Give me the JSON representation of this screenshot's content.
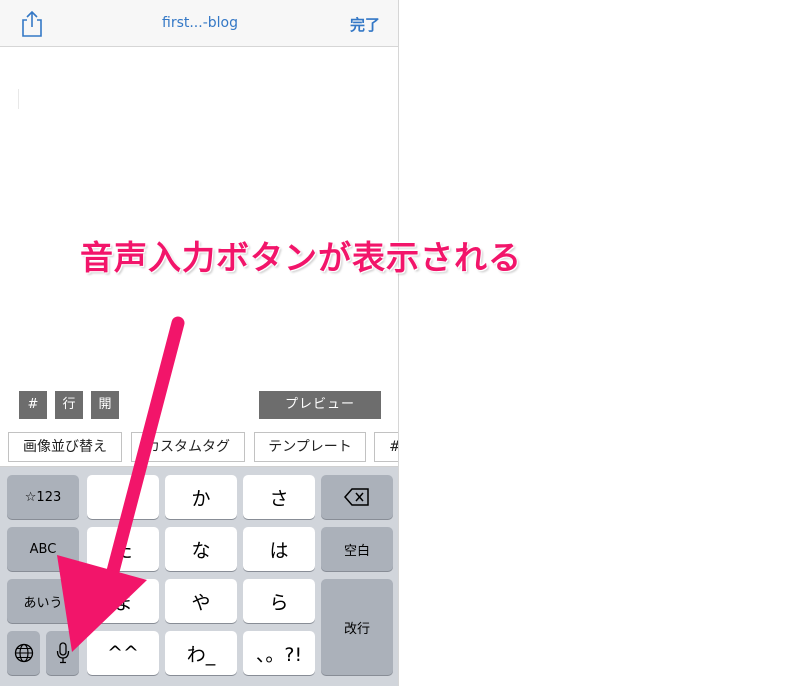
{
  "navbar": {
    "title": "first...-blog",
    "done_label": "完了",
    "share_icon": "share-icon"
  },
  "toolbar": {
    "hash_label": "#",
    "line_label": "行",
    "open_label": "開",
    "preview_label": "プレビュー"
  },
  "chips": [
    "画像並び替え",
    "カスタムタグ",
    "テンプレート",
    "#"
  ],
  "keyboard": {
    "row1": [
      "☆123",
      "",
      "か",
      "さ",
      "delete-icon"
    ],
    "row2": [
      "ABC",
      "た",
      "な",
      "は",
      "空白"
    ],
    "row3": [
      "あいう",
      "ま",
      "や",
      "ら"
    ],
    "row4": [
      "globe-icon",
      "microphone-icon",
      "^^",
      "わ_",
      "、。?!"
    ],
    "enter_label": "改行"
  },
  "annotation": {
    "text": "音声入力ボタンが表示される",
    "color": "#f2156a"
  }
}
